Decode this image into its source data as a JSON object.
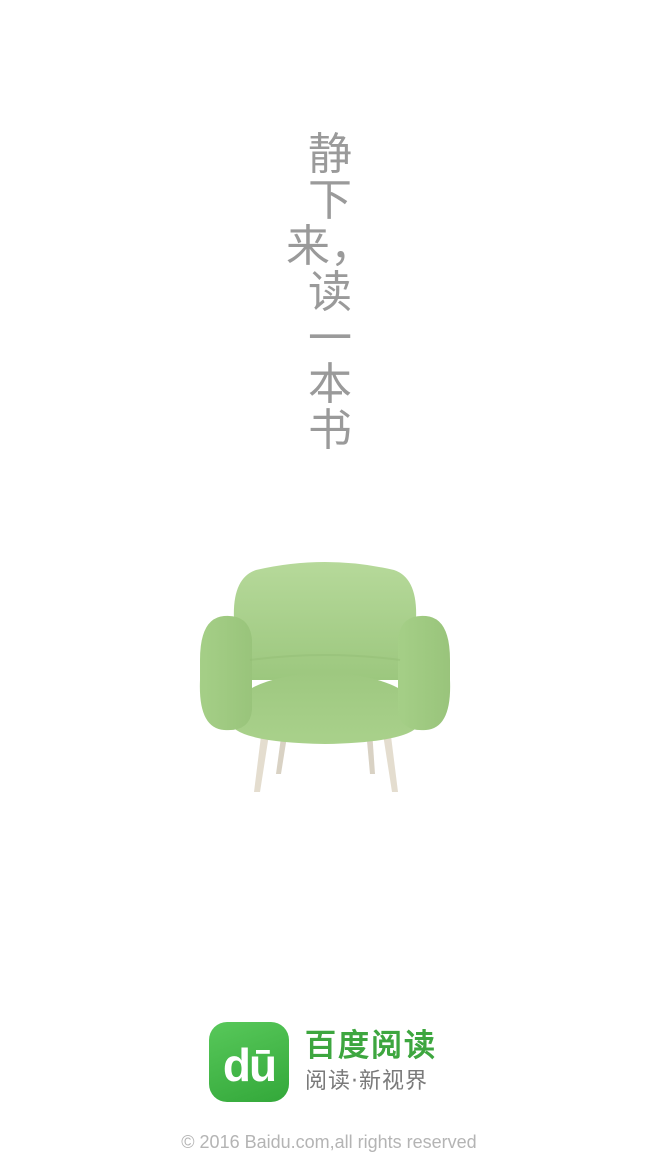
{
  "slogan": {
    "chars": [
      "静",
      "下",
      "来，",
      "读",
      "一",
      "本",
      "书"
    ]
  },
  "illustration": {
    "icon": "armchair-illustration",
    "seat_color": "#a8d08a",
    "leg_color": "#e3ddd0"
  },
  "brand": {
    "icon_text": "dū",
    "icon_color": "#41b246",
    "name": "百度阅读",
    "tagline": "阅读·新视界"
  },
  "footer": {
    "copyright": "© 2016 Baidu.com,all rights reserved"
  }
}
